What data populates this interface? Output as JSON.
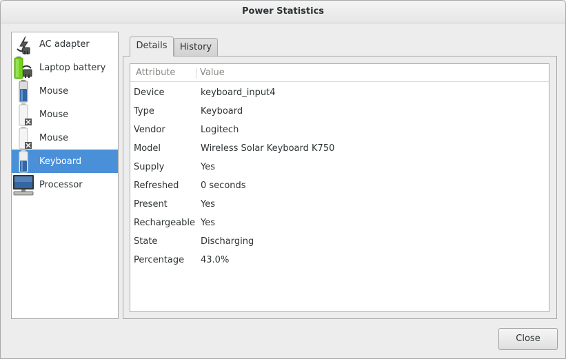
{
  "window": {
    "title": "Power Statistics"
  },
  "devices": [
    {
      "label": "AC adapter",
      "icon": "ac-adapter-icon",
      "selected": false
    },
    {
      "label": "Laptop battery",
      "icon": "laptop-battery-icon",
      "selected": false
    },
    {
      "label": "Mouse",
      "icon": "battery-icon",
      "selected": false
    },
    {
      "label": "Mouse",
      "icon": "battery-missing-icon",
      "selected": false
    },
    {
      "label": "Mouse",
      "icon": "battery-missing-icon",
      "selected": false
    },
    {
      "label": "Keyboard",
      "icon": "battery-icon",
      "selected": true
    },
    {
      "label": "Processor",
      "icon": "processor-icon",
      "selected": false
    }
  ],
  "tabs": [
    {
      "label": "Details",
      "active": true
    },
    {
      "label": "History",
      "active": false
    }
  ],
  "details": {
    "columns": {
      "attribute": "Attribute",
      "value": "Value"
    },
    "rows": [
      {
        "attribute": "Device",
        "value": "keyboard_input4"
      },
      {
        "attribute": "Type",
        "value": "Keyboard"
      },
      {
        "attribute": "Vendor",
        "value": "Logitech"
      },
      {
        "attribute": "Model",
        "value": "Wireless Solar Keyboard K750"
      },
      {
        "attribute": "Supply",
        "value": "Yes"
      },
      {
        "attribute": "Refreshed",
        "value": "0 seconds"
      },
      {
        "attribute": "Present",
        "value": "Yes"
      },
      {
        "attribute": "Rechargeable",
        "value": "Yes"
      },
      {
        "attribute": "State",
        "value": "Discharging"
      },
      {
        "attribute": "Percentage",
        "value": "43.0%"
      }
    ]
  },
  "buttons": {
    "close": "Close"
  },
  "colors": {
    "selection": "#4a90d9",
    "battery_blue": "#3465a4",
    "battery_green": "#73d216"
  }
}
